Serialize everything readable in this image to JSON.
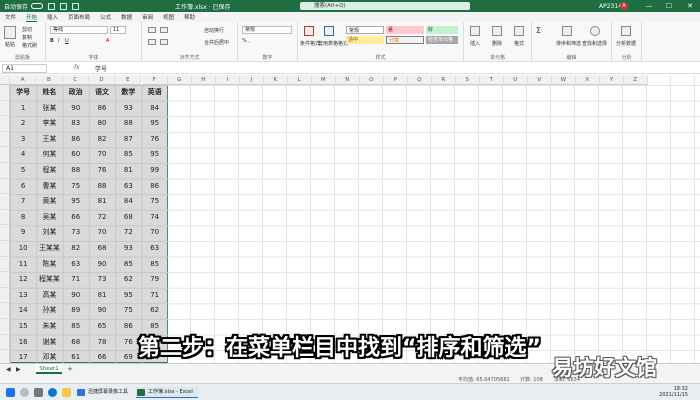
{
  "titlebar": {
    "autosave_label": "自动保存",
    "filename": "工作簿.xlsx · 已保存",
    "search_placeholder": "搜索(Alt+Q)",
    "user": "AP2314",
    "avatar": "A",
    "minimize": "—",
    "maximize": "☐",
    "close": "✕"
  },
  "tabs": [
    "文件",
    "开始",
    "插入",
    "页面布局",
    "公式",
    "数据",
    "审阅",
    "视图",
    "帮助"
  ],
  "ribbon": {
    "paste": "粘贴",
    "cut": "剪切",
    "copy": "复制",
    "format_painter": "格式刷",
    "font_name": "等线",
    "font_size": "11",
    "wrap": "自动换行",
    "merge": "合并后居中",
    "number_format": "常规",
    "cond_format": "条件格式",
    "table_format": "套用表格格式",
    "style_normal": "常规",
    "style_bad": "差",
    "style_good": "好",
    "style_neutral": "适中",
    "style_calc": "计算",
    "style_check": "检查单元格",
    "insert": "插入",
    "delete": "删除",
    "format": "格式",
    "sort_filter": "排序和筛选",
    "find_select": "查找和选择",
    "analyze": "分析数据",
    "groups": {
      "clipboard": "剪贴板",
      "font": "字体",
      "alignment": "对齐方式",
      "number": "数字",
      "styles": "样式",
      "cells": "单元格",
      "editing": "编辑",
      "analysis": "分析"
    }
  },
  "formula_bar": {
    "name_box": "A1",
    "fx": "fx",
    "content": "学号"
  },
  "columns": [
    "A",
    "B",
    "C",
    "D",
    "E",
    "F",
    "G",
    "H",
    "I",
    "J",
    "K",
    "L",
    "M",
    "N",
    "O",
    "P",
    "Q",
    "R",
    "S",
    "T",
    "U",
    "V",
    "W",
    "X",
    "Y",
    "Z"
  ],
  "table": {
    "headers": [
      "学号",
      "姓名",
      "政治",
      "语文",
      "数学",
      "英语"
    ],
    "rows": [
      [
        "1",
        "张某",
        "90",
        "86",
        "93",
        "84"
      ],
      [
        "2",
        "李某",
        "83",
        "80",
        "88",
        "95"
      ],
      [
        "3",
        "王某",
        "86",
        "82",
        "87",
        "76"
      ],
      [
        "4",
        "何某",
        "60",
        "70",
        "85",
        "95"
      ],
      [
        "5",
        "程某",
        "88",
        "76",
        "81",
        "99"
      ],
      [
        "6",
        "曹某",
        "75",
        "88",
        "63",
        "86"
      ],
      [
        "7",
        "黄某",
        "95",
        "81",
        "84",
        "75"
      ],
      [
        "8",
        "吴某",
        "66",
        "72",
        "68",
        "74"
      ],
      [
        "9",
        "刘某",
        "73",
        "70",
        "72",
        "70"
      ],
      [
        "10",
        "王某某",
        "82",
        "68",
        "93",
        "63"
      ],
      [
        "11",
        "陈某",
        "63",
        "90",
        "85",
        "85"
      ],
      [
        "12",
        "程某某",
        "71",
        "73",
        "62",
        "79"
      ],
      [
        "13",
        "高某",
        "90",
        "81",
        "95",
        "71"
      ],
      [
        "14",
        "孙某",
        "89",
        "90",
        "75",
        "62"
      ],
      [
        "15",
        "朱某",
        "85",
        "65",
        "86",
        "85"
      ],
      [
        "16",
        "谢某",
        "68",
        "78",
        "76",
        "95"
      ],
      [
        "17",
        "邓某",
        "61",
        "66",
        "69",
        "94"
      ]
    ]
  },
  "sheet_tab": "Sheet1",
  "add_sheet": "+",
  "status": {
    "average": "平均值: 65.04705882",
    "count": "计数: 108",
    "sum": "求和: 6634"
  },
  "taskbar": {
    "app1": "迅捷屏幕录像工具",
    "app2": "工作簿.xlsx - Excel",
    "time": "18:32",
    "date": "2021/11/15"
  },
  "caption": "第二步：在菜单栏目中找到“排序和筛选”",
  "watermark": "易坊好文馆",
  "colors": {
    "excel_green": "#1e6e42",
    "selection_bg": "#dadada"
  }
}
